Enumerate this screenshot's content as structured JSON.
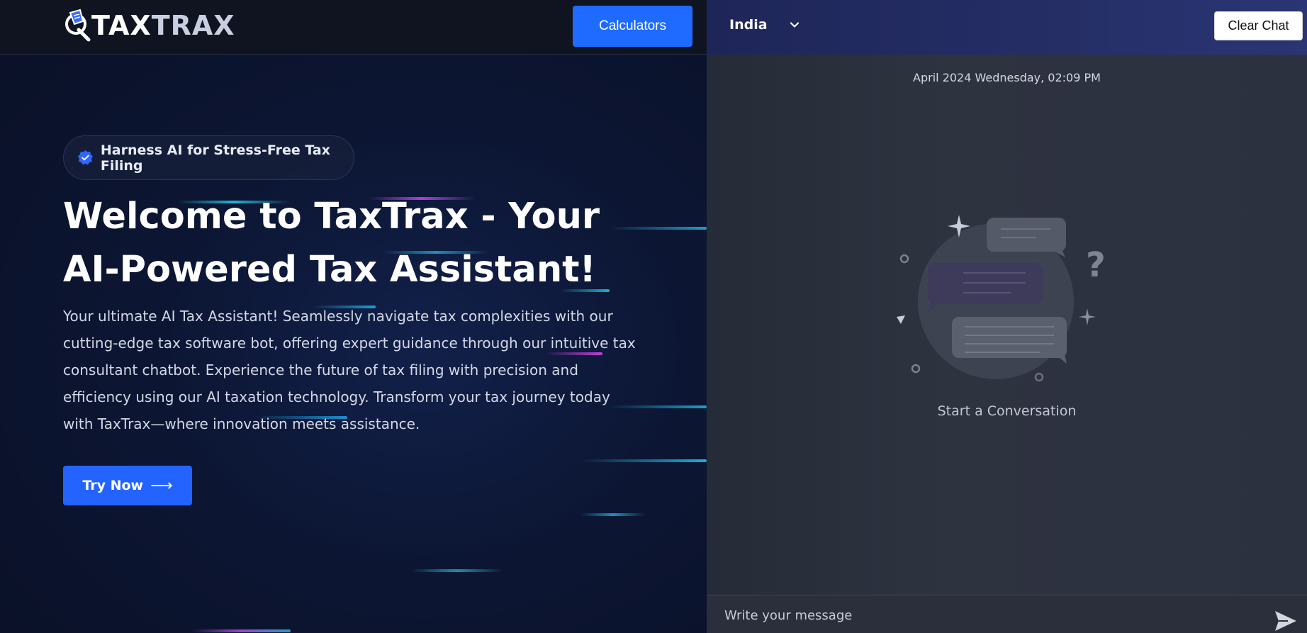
{
  "header": {
    "logo_text_a": "TAX",
    "logo_text_b": "TRAX",
    "calculators_label": "Calculators"
  },
  "hero": {
    "badge_text": "Harness AI for Stress-Free Tax Filing",
    "title": "Welcome to TaxTrax - Your AI-Powered Tax Assistant!",
    "description": "Your ultimate AI Tax Assistant! Seamlessly navigate tax complexities with our cutting-edge tax software bot, offering expert guidance through our intuitive tax consultant chatbot. Experience the future of tax filing with precision and efficiency using our AI taxation technology. Transform your tax journey today with TaxTrax—where innovation meets assistance.",
    "try_now_label": "Try Now",
    "try_now_arrow": "⟶"
  },
  "chat": {
    "country_selected": "India",
    "clear_chat_label": "Clear Chat",
    "timestamp": "April 2024 Wednesday, 02:09 PM",
    "empty_state_label": "Start a Conversation",
    "input_placeholder": "Write your message",
    "input_value": ""
  },
  "icons": {
    "logo": "taxtrax-logo-icon",
    "badge": "verified-check-icon",
    "country_dropdown": "chevron-down-icon",
    "send": "send-icon",
    "empty_state": "chat-bubbles-illustration"
  },
  "colors": {
    "accent": "#1f6bff",
    "left_bg": "#0c1633",
    "right_bg": "#2c3140",
    "right_header": "#252f66"
  }
}
